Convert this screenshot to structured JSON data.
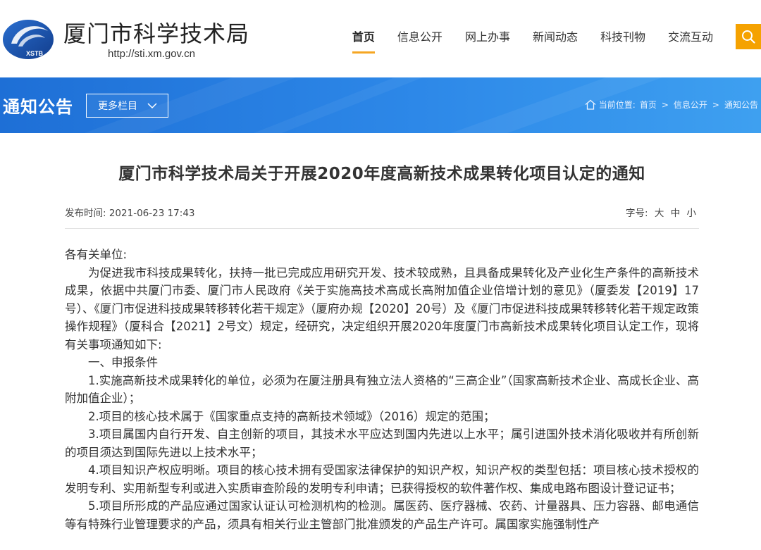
{
  "site": {
    "title": "厦门市科学技术局",
    "url": "http://sti.xm.gov.cn",
    "logo_text": "XSTB"
  },
  "nav": {
    "items": [
      {
        "label": "首页",
        "active": true
      },
      {
        "label": "信息公开",
        "active": false
      },
      {
        "label": "网上办事",
        "active": false
      },
      {
        "label": "新闻动态",
        "active": false
      },
      {
        "label": "科技刊物",
        "active": false
      },
      {
        "label": "交流互动",
        "active": false
      }
    ]
  },
  "banner": {
    "title": "通知公告",
    "more_label": "更多栏目"
  },
  "breadcrumb": {
    "prefix": "当前位置:",
    "items": [
      "首页",
      "信息公开",
      "通知公告"
    ]
  },
  "article": {
    "title": "厦门市科学技术局关于开展2020年度高新技术成果转化项目认定的通知",
    "date_label": "发布时间: 2021-06-23 17:43",
    "font_label": "字号:",
    "font_options": [
      "大",
      "中",
      "小"
    ],
    "paragraphs": [
      {
        "text": "各有关单位:",
        "indent": false
      },
      {
        "text": "为促进我市科技成果转化，扶持一批已完成应用研究开发、技术较成熟，且具备成果转化及产业化生产条件的高新技术成果，依据中共厦门市委、厦门市人民政府《关于实施高技术高成长高附加值企业倍增计划的意见》（厦委发【2019】17号）、《厦门市促进科技成果转移转化若干规定》（厦府办规【2020】20号）及《厦门市促进科技成果转移转化若干规定政策操作规程》（厦科合【2021】2号文）规定，经研究，决定组织开展2020年度厦门市高新技术成果转化项目认定工作，现将有关事项通知如下:",
        "indent": true
      },
      {
        "text": "一、申报条件",
        "indent": true
      },
      {
        "text": "1.实施高新技术成果转化的单位，必须为在厦注册具有独立法人资格的“三高企业”（国家高新技术企业、高成长企业、高附加值企业）；",
        "indent": true
      },
      {
        "text": "2.项目的核心技术属于《国家重点支持的高新技术领域》（2016）规定的范围；",
        "indent": true
      },
      {
        "text": "3.项目属国内自行开发、自主创新的项目，其技术水平应达到国内先进以上水平；属引进国外技术消化吸收并有所创新的项目须达到国际先进以上技术水平；",
        "indent": true
      },
      {
        "text": "4.项目知识产权应明晰。项目的核心技术拥有受国家法律保护的知识产权，知识产权的类型包括：项目核心技术授权的发明专利、实用新型专利或进入实质审查阶段的发明专利申请；已获得授权的软件著作权、集成电路布图设计登记证书；",
        "indent": true
      },
      {
        "text": "5.项目所形成的产品应通过国家认证认可检测机构的检测。属医药、医疗器械、农药、计量器具、压力容器、邮电通信等有特殊行业管理要求的产品，须具有相关行业主管部门批准颁发的产品生产许可。属国家实施强制性产",
        "indent": true
      }
    ]
  },
  "colors": {
    "banner_blue": "#1e6fd6",
    "accent_orange": "#f5a200",
    "logo_blue": "#1a4fa0"
  }
}
